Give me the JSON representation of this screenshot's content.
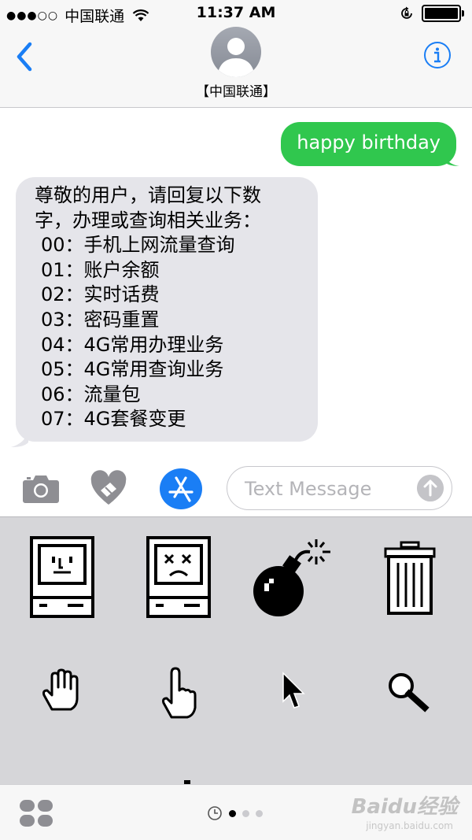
{
  "status_bar": {
    "signal_dots": "●●●○○",
    "carrier": "中国联通",
    "time": "11:37 AM"
  },
  "header": {
    "contact_name": "【中国联通】",
    "back_icon": "chevron-left-icon",
    "info_icon": "info-icon"
  },
  "conversation": {
    "sent_message": "happy birthday",
    "received_message_lines": [
      "尊敬的用户，请回复以下数",
      "字，办理或查询相关业务：",
      "00：手机上网流量查询",
      "01：账户余额",
      "02：实时话费",
      "03：密码重置",
      "04：4G常用办理业务",
      "05：4G常用查询业务",
      "06：流量包",
      "07：4G套餐变更"
    ]
  },
  "input_bar": {
    "placeholder": "Text Message",
    "camera_icon": "camera-icon",
    "digital_touch_icon": "heart-icon",
    "app_store_icon": "app-store-icon",
    "send_icon": "arrow-up-icon"
  },
  "sticker_drawer": {
    "stickers": [
      "happy-mac",
      "sad-mac",
      "bomb",
      "trash-can",
      "grab-hand",
      "pointing-hand",
      "arrow-cursor",
      "magnifier"
    ]
  },
  "bottom_bar": {
    "page_count": 3,
    "active_page": 1
  },
  "watermark": {
    "brand": "Baidu经验",
    "url": "jingyan.baidu.com"
  },
  "colors": {
    "sent_bubble": "#30c74e",
    "received_bubble": "#e5e5ea",
    "accent": "#1a7ef5",
    "drawer_bg": "#d6d6d9"
  }
}
